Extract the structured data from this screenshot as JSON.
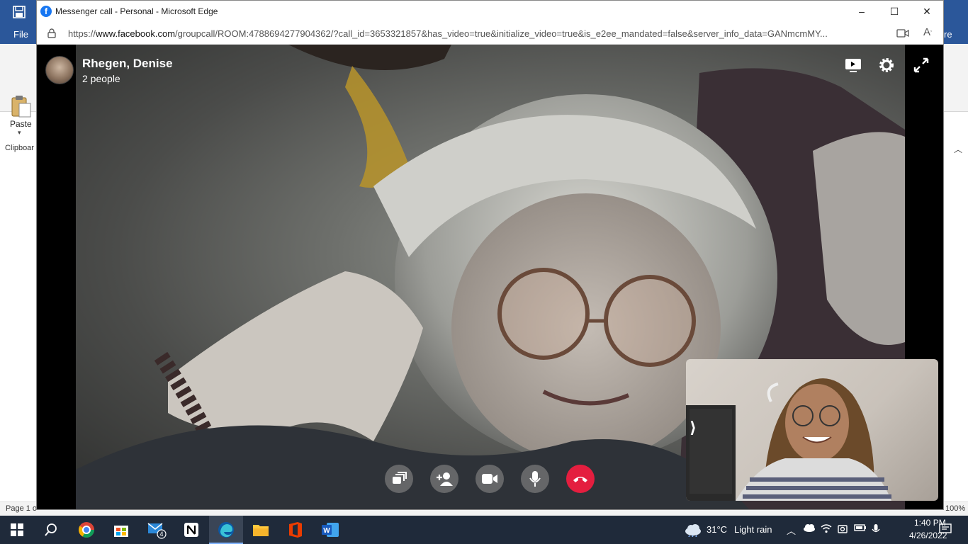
{
  "word": {
    "file_tab": "File",
    "right_tab_fragment": "re",
    "paste_label": "Paste",
    "clipboard_label": "Clipboar",
    "page_indicator": "Page 1 o",
    "zoom": "100%"
  },
  "browser": {
    "window_title": "Messenger call - Personal - Microsoft Edge",
    "url_prefix": "https://",
    "url_host": "www.facebook.com",
    "url_rest": "/groupcall/ROOM:4788694277904362/?call_id=3653321857&has_video=true&initialize_video=true&is_e2ee_mandated=false&server_info_data=GANmcmMY...",
    "minimize": "–",
    "maximize": "☐",
    "close": "✕"
  },
  "call": {
    "caller_name": "Rhegen, Denise",
    "participant_count": "2 people",
    "icons": {
      "screen": "screen-share-icon",
      "settings": "settings-gear-icon",
      "fullscreen": "fullscreen-icon"
    },
    "controls": [
      "switch-view",
      "add-person",
      "camera",
      "microphone",
      "end-call"
    ],
    "end_call_color": "#e41e3f"
  },
  "taskbar": {
    "mail_badge": "4",
    "weather_temp": "31°C",
    "weather_desc": "Light rain",
    "time": "1:40 PM",
    "date": "4/26/2022"
  }
}
